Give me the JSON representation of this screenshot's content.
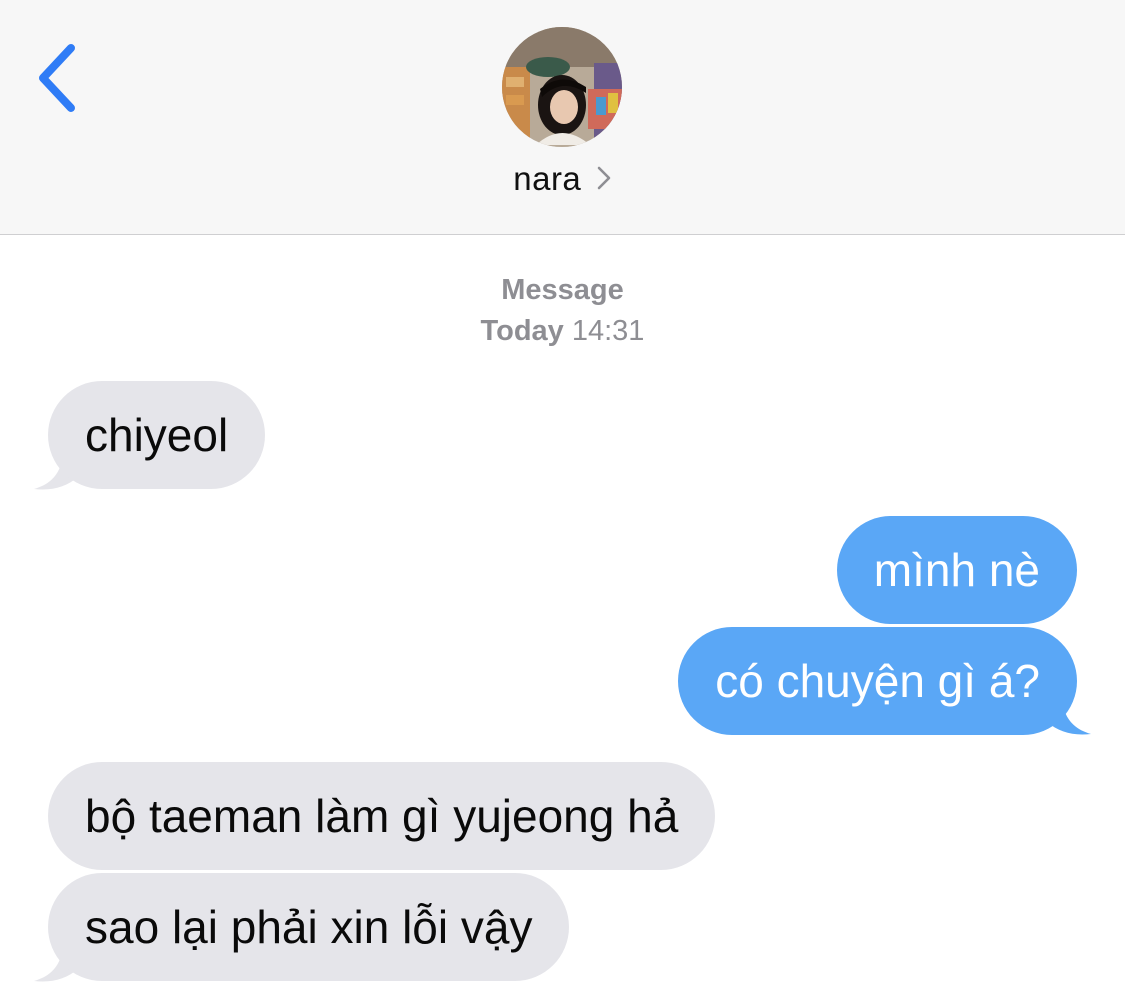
{
  "header": {
    "back_icon": "chevron-left-icon",
    "accent_color": "#2f7cf6",
    "contact_name": "nara",
    "contact_chevron_icon": "chevron-right-icon"
  },
  "thread": {
    "timestamp_label": "Message",
    "timestamp_day": "Today",
    "timestamp_time": "14:31",
    "messages": [
      {
        "direction": "received",
        "text": "chiyeol"
      },
      {
        "direction": "sent",
        "text": "mình nè"
      },
      {
        "direction": "sent",
        "text": "có chuyện gì á?"
      },
      {
        "direction": "received",
        "text": "bộ taeman làm gì yujeong hả"
      },
      {
        "direction": "received",
        "text": "sao lại phải xin lỗi vậy"
      }
    ]
  },
  "colors": {
    "sent_bubble": "#5aa7f6",
    "received_bubble": "#e5e5ea",
    "header_background": "#f7f7f7"
  }
}
